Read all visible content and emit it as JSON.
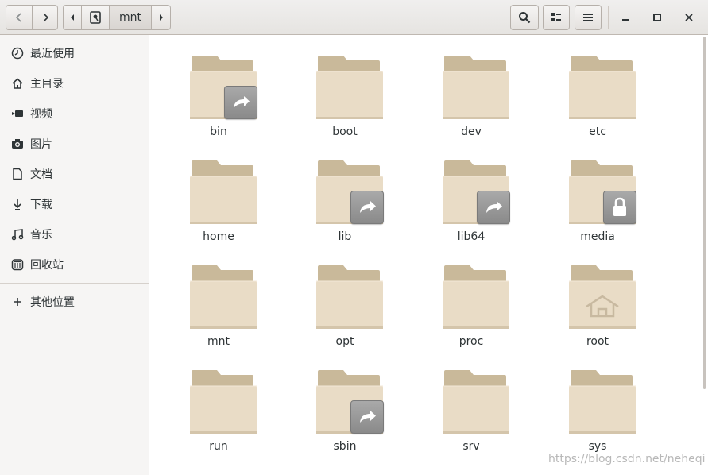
{
  "header": {
    "path": "mnt",
    "icons": {
      "back": "chevron-left-icon",
      "forward": "chevron-right-icon",
      "path_left": "path-left-arrow-icon",
      "path_right": "path-right-arrow-icon",
      "drive": "drive-icon",
      "search": "search-icon",
      "view": "view-list-icon",
      "menu": "hamburger-menu-icon",
      "minimize": "minimize-icon",
      "maximize": "maximize-icon",
      "close": "close-icon"
    }
  },
  "sidebar": {
    "items": [
      {
        "label": "最近使用",
        "icon": "clock-icon"
      },
      {
        "label": "主目录",
        "icon": "home-icon"
      },
      {
        "label": "视频",
        "icon": "video-icon"
      },
      {
        "label": "图片",
        "icon": "camera-icon"
      },
      {
        "label": "文档",
        "icon": "document-icon"
      },
      {
        "label": "下载",
        "icon": "download-icon"
      },
      {
        "label": "音乐",
        "icon": "music-icon"
      },
      {
        "label": "回收站",
        "icon": "trash-icon"
      },
      {
        "label": "其他位置",
        "icon": "plus-icon"
      }
    ]
  },
  "files": [
    {
      "name": "bin",
      "emblem": "symlink"
    },
    {
      "name": "boot",
      "emblem": ""
    },
    {
      "name": "dev",
      "emblem": ""
    },
    {
      "name": "etc",
      "emblem": ""
    },
    {
      "name": "home",
      "emblem": ""
    },
    {
      "name": "lib",
      "emblem": "symlink"
    },
    {
      "name": "lib64",
      "emblem": "symlink"
    },
    {
      "name": "media",
      "emblem": "lock"
    },
    {
      "name": "mnt",
      "emblem": ""
    },
    {
      "name": "opt",
      "emblem": ""
    },
    {
      "name": "proc",
      "emblem": ""
    },
    {
      "name": "root",
      "emblem": "home"
    },
    {
      "name": "run",
      "emblem": ""
    },
    {
      "name": "sbin",
      "emblem": "symlink"
    },
    {
      "name": "srv",
      "emblem": ""
    },
    {
      "name": "sys",
      "emblem": ""
    }
  ],
  "watermark": "https://blog.csdn.net/neheqi",
  "colors": {
    "folder_back": "#c9b99a",
    "folder_front": "#e9dcc6",
    "header_bg": "#e6e4e1",
    "sidebar_bg": "#f6f5f4"
  }
}
